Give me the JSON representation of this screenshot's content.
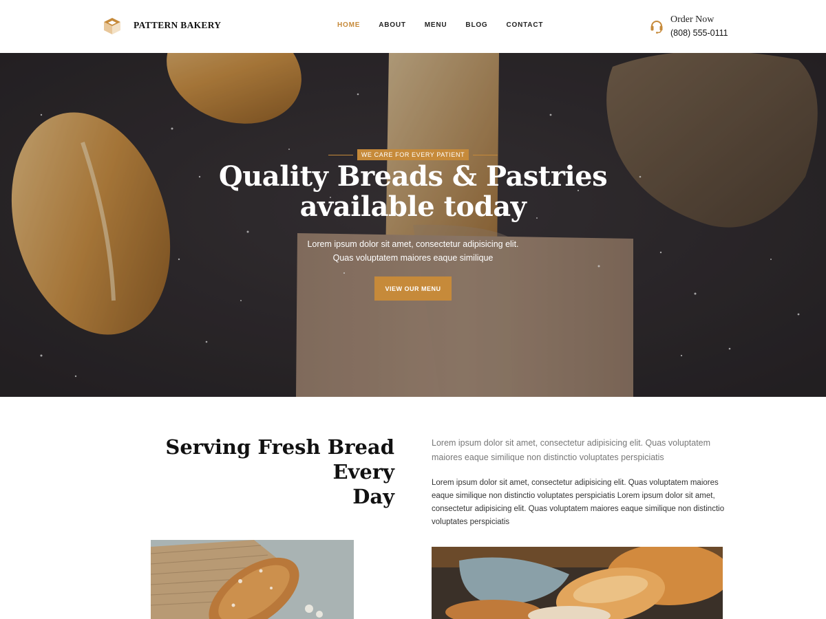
{
  "brand": {
    "name": "PATTERN BAKERY",
    "accent_color": "#c68a3a",
    "logo_icon": "bakery-logo-icon"
  },
  "nav": {
    "items": [
      {
        "label": "HOME",
        "active": true
      },
      {
        "label": "ABOUT",
        "active": false
      },
      {
        "label": "MENU",
        "active": false
      },
      {
        "label": "BLOG",
        "active": false
      },
      {
        "label": "CONTACT",
        "active": false
      }
    ]
  },
  "order": {
    "icon": "headset-icon",
    "title": "Order Now",
    "phone": "(808) 555-0111"
  },
  "hero": {
    "badge": "WE CARE FOR EVERY PATIENT",
    "title_line1": "Quality Breads & Pastries",
    "title_line2": "available today",
    "subtitle_line1": "Lorem ipsum dolor sit amet, consectetur adipisicing elit.",
    "subtitle_line2": "Quas voluptatem maiores eaque similique",
    "button": "VIEW OUR MENU"
  },
  "about": {
    "title_line1": "Serving Fresh Bread Every",
    "title_line2": "Day",
    "lead": "Lorem ipsum dolor sit amet, consectetur adipisicing elit. Quas voluptatem maiores eaque similique non distinctio voluptates perspiciatis",
    "body": "Lorem ipsum dolor sit amet, consectetur adipisicing elit. Quas voluptatem maiores eaque similique non distinctio voluptates perspiciatis Lorem ipsum dolor sit amet, consectetur adipisicing elit. Quas voluptatem maiores eaque similique non distinctio voluptates perspiciatis"
  }
}
